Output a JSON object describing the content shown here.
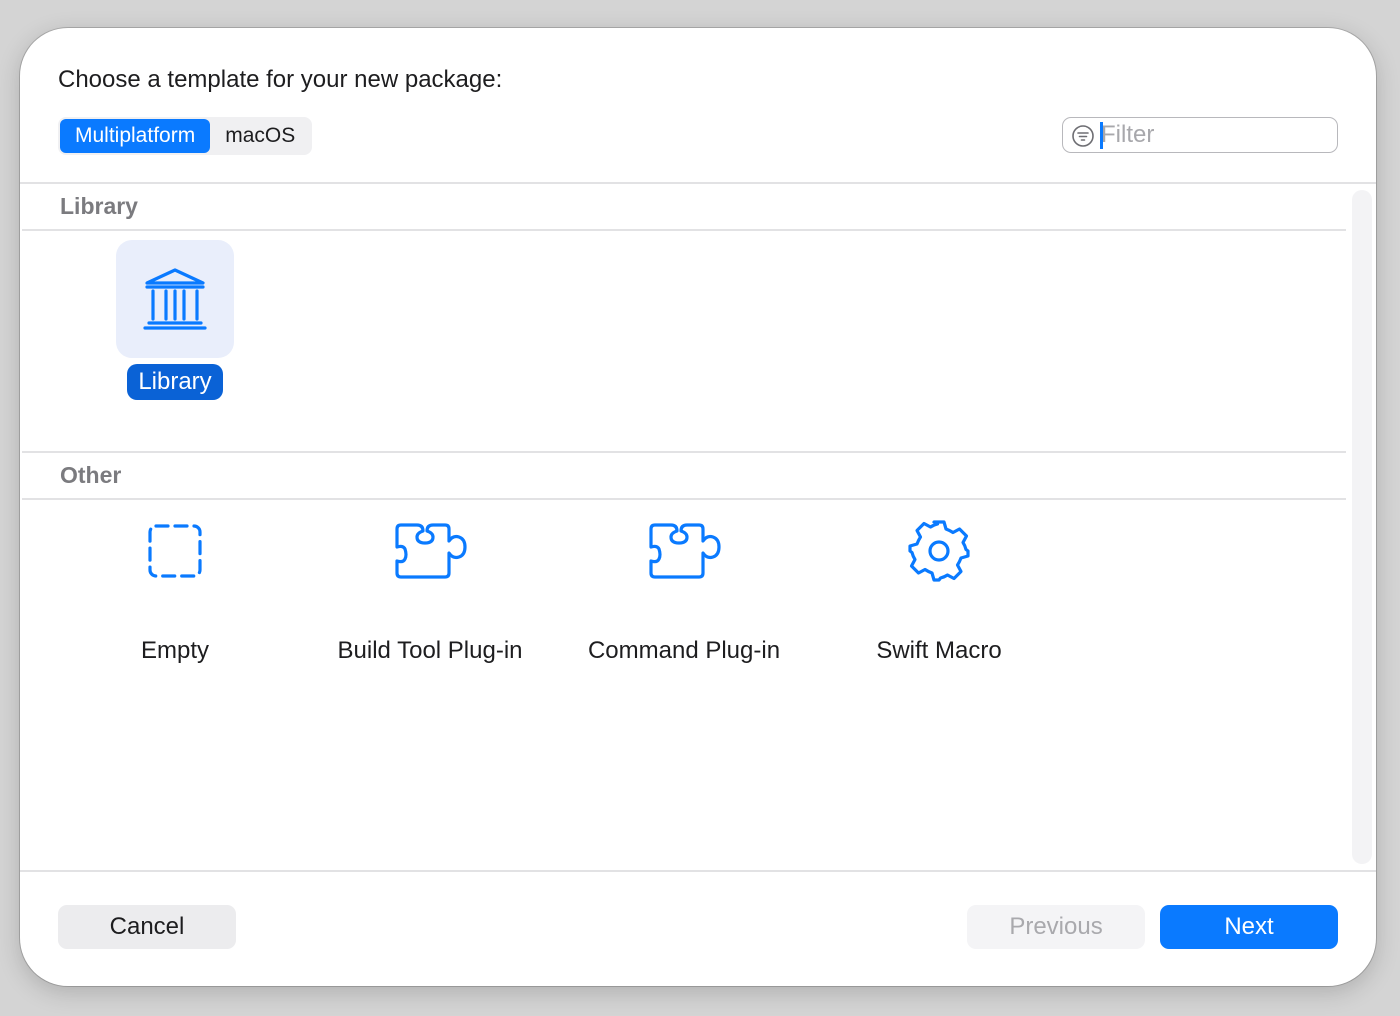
{
  "dialog": {
    "prompt": "Choose a template for your new package:"
  },
  "platforms": {
    "tabs": [
      {
        "label": "Multiplatform",
        "selected": true
      },
      {
        "label": "macOS",
        "selected": false
      }
    ]
  },
  "filter": {
    "placeholder": "Filter",
    "value": ""
  },
  "sections": {
    "library": {
      "title": "Library",
      "items": [
        {
          "label": "Library",
          "icon": "building-columns-icon",
          "selected": true
        }
      ]
    },
    "other": {
      "title": "Other",
      "items": [
        {
          "label": "Empty",
          "icon": "dashed-square-icon"
        },
        {
          "label": "Build Tool Plug-in",
          "icon": "puzzle-piece-icon"
        },
        {
          "label": "Command Plug-in",
          "icon": "puzzle-piece-icon"
        },
        {
          "label": "Swift Macro",
          "icon": "gear-icon"
        }
      ]
    }
  },
  "buttons": {
    "cancel": "Cancel",
    "previous": "Previous",
    "next": "Next"
  },
  "colors": {
    "accent": "#0a7aff",
    "selection": "#0a62d6",
    "icon": "#0a7aff"
  }
}
